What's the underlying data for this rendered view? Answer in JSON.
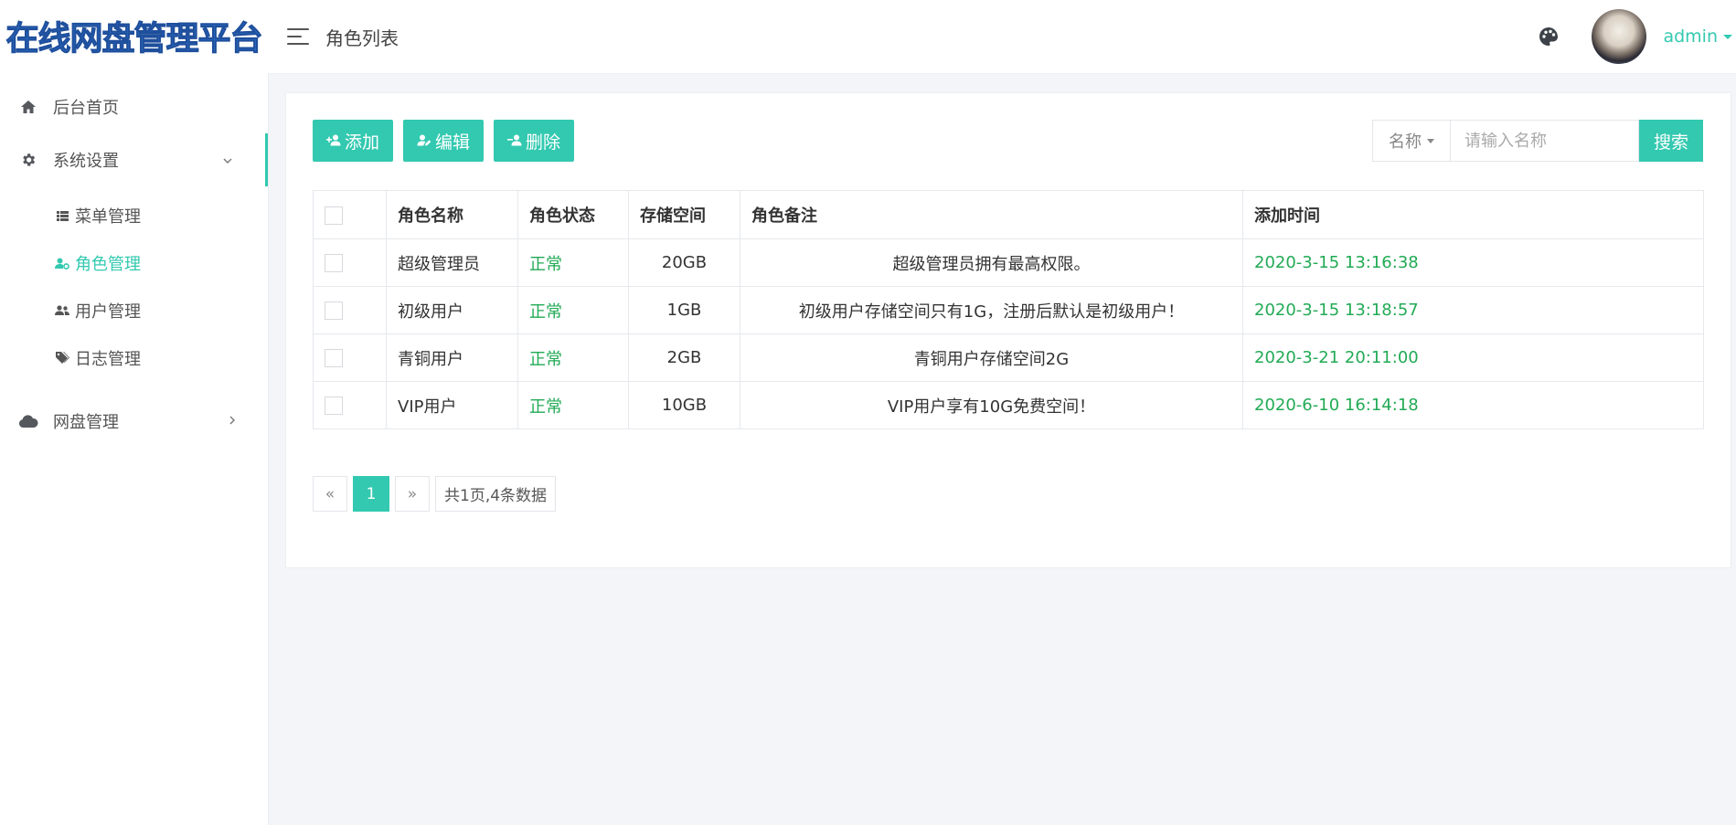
{
  "app": {
    "logo": "在线网盘管理平台"
  },
  "header": {
    "page_title": "角色列表",
    "user": "admin"
  },
  "sidebar": {
    "items": [
      {
        "label": "后台首页",
        "icon": "home-icon"
      },
      {
        "label": "系统设置",
        "icon": "gear-icon",
        "expanded": true,
        "children": [
          {
            "label": "菜单管理",
            "icon": "list-icon"
          },
          {
            "label": "角色管理",
            "icon": "user-gear-icon",
            "active": true
          },
          {
            "label": "用户管理",
            "icon": "users-icon"
          },
          {
            "label": "日志管理",
            "icon": "tags-icon"
          }
        ]
      },
      {
        "label": "网盘管理",
        "icon": "cloud-icon",
        "expanded": false
      }
    ]
  },
  "toolbar": {
    "add": "添加",
    "edit": "编辑",
    "delete": "删除"
  },
  "search": {
    "field": "名称",
    "placeholder": "请输入名称",
    "button": "搜索"
  },
  "table": {
    "columns": [
      "角色名称",
      "角色状态",
      "存储空间",
      "角色备注",
      "添加时间"
    ],
    "rows": [
      {
        "name": "超级管理员",
        "status": "正常",
        "space": "20GB",
        "remark": "超级管理员拥有最高权限。",
        "time": "2020-3-15 13:16:38"
      },
      {
        "name": "初级用户",
        "status": "正常",
        "space": "1GB",
        "remark": "初级用户存储空间只有1G，注册后默认是初级用户！",
        "time": "2020-3-15 13:18:57"
      },
      {
        "name": "青铜用户",
        "status": "正常",
        "space": "2GB",
        "remark": "青铜用户存储空间2G",
        "time": "2020-3-21 20:11:00"
      },
      {
        "name": "VIP用户",
        "status": "正常",
        "space": "10GB",
        "remark": "VIP用户享有10G免费空间！",
        "time": "2020-6-10 16:14:18"
      }
    ]
  },
  "pager": {
    "prev": "«",
    "current": "1",
    "next": "»",
    "info": "共1页,4条数据"
  },
  "colors": {
    "accent": "#33c9b0",
    "status_green": "#22aa55"
  }
}
